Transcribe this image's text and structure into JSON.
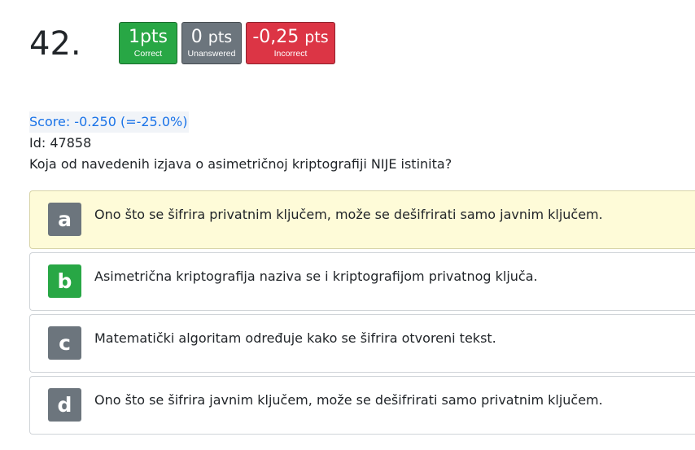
{
  "question": {
    "number": "42."
  },
  "badges": [
    {
      "value": "1pts",
      "unit": "",
      "label": "Correct",
      "color": "#28a745"
    },
    {
      "value": "0",
      "unit": "pts",
      "label": "Unanswered",
      "color": "#6c757d"
    },
    {
      "value": "-0,25",
      "unit": "pts",
      "label": "Incorrect",
      "color": "#dc3545"
    }
  ],
  "meta": {
    "score": "Score: -0.250 (=-25.0%)",
    "id": "Id: 47858",
    "text": "Koja od navedenih izjava o asimetričnoj kriptografiji NIJE istinita?"
  },
  "answers": [
    {
      "letter": "a",
      "text": "Ono što se šifrira privatnim ključem, može se dešifrirati samo javnim ključem.",
      "selected": true,
      "letter_color": "#6c757d"
    },
    {
      "letter": "b",
      "text": "Asimetrična kriptografija naziva se i kriptografijom privatnog ključa.",
      "selected": false,
      "letter_color": "#28a745"
    },
    {
      "letter": "c",
      "text": "Matematički algoritam određuje kako se šifrira otvoreni tekst.",
      "selected": false,
      "letter_color": "#6c757d"
    },
    {
      "letter": "d",
      "text": "Ono što se šifrira javnim ključem, može se dešifrirati samo privatnim ključem.",
      "selected": false,
      "letter_color": "#6c757d"
    }
  ],
  "colors": {
    "selected_bg": "#fefbd8",
    "score_text": "#1a73e8"
  }
}
